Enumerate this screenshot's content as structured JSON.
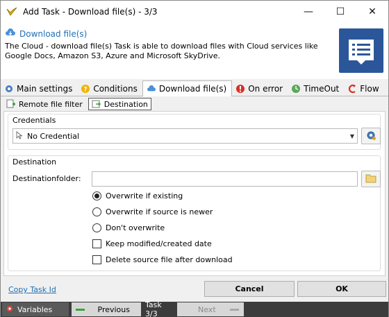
{
  "window": {
    "title": "Add Task - Download file(s) - 3/3",
    "minimize_glyph": "—",
    "maximize_glyph": "☐",
    "close_glyph": "✕"
  },
  "header": {
    "title": "Download file(s)",
    "description": "The Cloud - download file(s) Task is able to download files with Cloud services like Google Docs, Amazon S3, Azure and Microsoft SkyDrive."
  },
  "tabs": [
    {
      "label": "Main settings",
      "icon": "gears-icon"
    },
    {
      "label": "Conditions",
      "icon": "question-icon"
    },
    {
      "label": "Download file(s)",
      "icon": "cloud-icon"
    },
    {
      "label": "On error",
      "icon": "error-icon"
    },
    {
      "label": "TimeOut",
      "icon": "clock-icon"
    },
    {
      "label": "Flow",
      "icon": "flow-icon"
    }
  ],
  "subtabs": [
    {
      "label": "Remote file filter",
      "icon": "filter-add-icon"
    },
    {
      "label": "Destination",
      "icon": "destination-icon"
    }
  ],
  "credentials": {
    "group_title": "Credentials",
    "selected": "No Credential"
  },
  "destination": {
    "group_title": "Destination",
    "folder_label": "Destinationfolder:",
    "folder_value": "",
    "options": [
      {
        "label": "Overwrite if existing",
        "type": "radio",
        "checked": true
      },
      {
        "label": "Overwrite if source is newer",
        "type": "radio",
        "checked": false
      },
      {
        "label": "Don't overwrite",
        "type": "radio",
        "checked": false
      },
      {
        "label": "Keep modified/created date",
        "type": "checkbox",
        "checked": false
      },
      {
        "label": "Delete source file after download",
        "type": "checkbox",
        "checked": false
      }
    ]
  },
  "footer": {
    "copy_link": "Copy Task Id",
    "cancel_label": "Cancel",
    "ok_label": "OK"
  },
  "statusbar": {
    "variables_label": "Variables",
    "previous_label": "Previous",
    "task_counter": "Task 3/3",
    "next_label": "Next"
  },
  "colors": {
    "accent": "#1f6fb5",
    "header_icon_bg": "#2b579a",
    "statusbar_bg": "#3c3c3c"
  }
}
